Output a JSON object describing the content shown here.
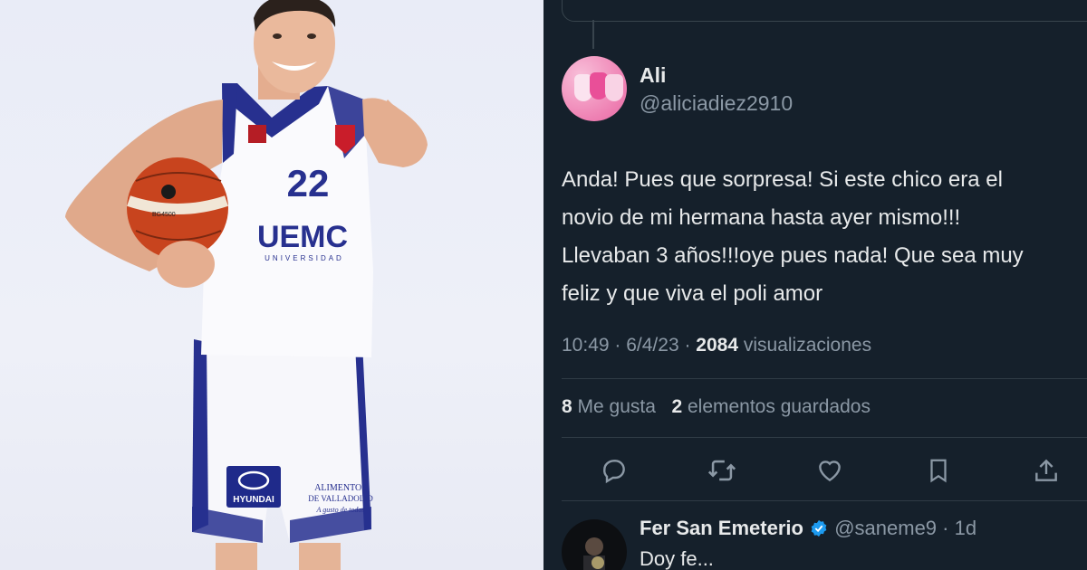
{
  "photo": {
    "jersey_number": "22",
    "jersey_brand": "UEMC",
    "jersey_sub": "UNIVERSIDAD",
    "sponsor_1": "HYUNDAI",
    "sponsor_2_line1": "ALIMENTOS",
    "sponsor_2_line2": "DE VALLADOLID",
    "sponsor_2_line3": "A gusto de todos",
    "ball_text": "BG4500"
  },
  "tweet": {
    "author_name": "Ali",
    "author_handle": "@aliciadiez2910",
    "text_lines": [
      "Anda! Pues que sorpresa! Si este chico era el",
      "novio de mi hermana hasta ayer mismo!!!",
      "Llevaban 3 años!!!oye pues nada! Que sea muy",
      "feliz y que viva el poli amor"
    ],
    "time": "10:49",
    "date": "6/4/23",
    "views_count": "2084",
    "views_label": "visualizaciones",
    "likes_count": "8",
    "likes_label": "Me gusta",
    "bookmarks_count": "2",
    "bookmarks_label": "elementos guardados"
  },
  "actions": [
    "reply-icon",
    "retweet-icon",
    "like-icon",
    "bookmark-icon",
    "share-icon"
  ],
  "reply": {
    "author_name": "Fer San Emeterio",
    "author_handle": "@saneme9",
    "age": "1d",
    "text": "Doy fe..."
  },
  "colors": {
    "background": "#15202b",
    "text_primary": "#e7e9ea",
    "text_secondary": "#8b98a5",
    "verified": "#1d9bf0",
    "jersey_navy": "#27308f"
  }
}
